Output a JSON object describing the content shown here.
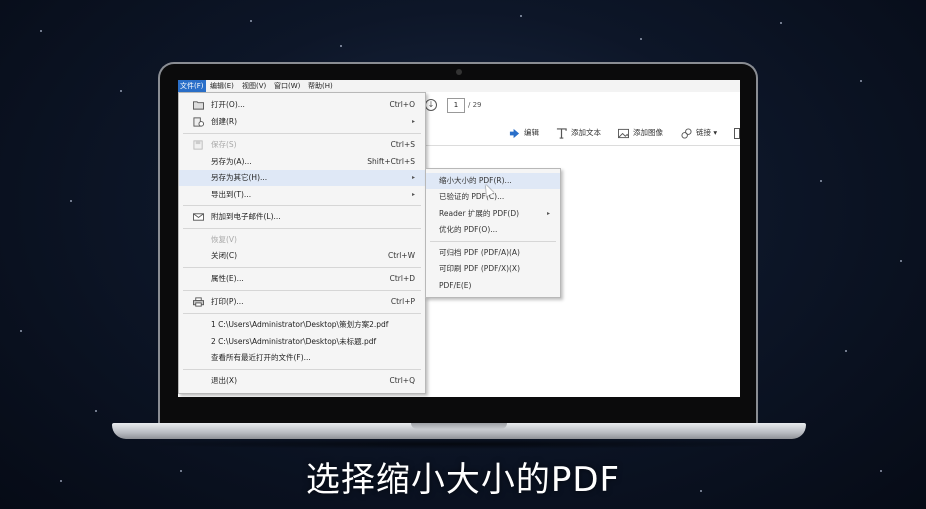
{
  "menubar": [
    "文件(F)",
    "编辑(E)",
    "视图(V)",
    "窗口(W)",
    "帮助(H)"
  ],
  "toolbar": {
    "page_number": "1",
    "page_total": "/ 29",
    "edit": "编辑",
    "add_text": "添加文本",
    "add_image": "添加图像",
    "link": "链接 ▾"
  },
  "file_menu": [
    {
      "label": "打开(O)...",
      "shortcut": "Ctrl+O",
      "icon": "folder-open-icon"
    },
    {
      "label": "创建(R)",
      "shortcut": "",
      "icon": "create-icon",
      "submenu": true
    },
    {
      "label": "保存(S)",
      "shortcut": "Ctrl+S",
      "icon": "save-icon",
      "disabled": true
    },
    {
      "label": "另存为(A)...",
      "shortcut": "Shift+Ctrl+S"
    },
    {
      "label": "另存为其它(H)...",
      "shortcut": "",
      "submenu": true,
      "highlighted": true
    },
    {
      "label": "导出到(T)...",
      "shortcut": "",
      "submenu": true
    },
    {
      "label": "附加到电子邮件(L)...",
      "shortcut": "",
      "icon": "mail-icon"
    },
    {
      "label": "恢复(V)",
      "shortcut": "",
      "disabled": true
    },
    {
      "label": "关闭(C)",
      "shortcut": "Ctrl+W"
    },
    {
      "label": "属性(E)...",
      "shortcut": "Ctrl+D"
    },
    {
      "label": "打印(P)...",
      "shortcut": "Ctrl+P",
      "icon": "print-icon"
    },
    {
      "label": "1 C:\\Users\\Administrator\\Desktop\\策划方案2.pdf",
      "shortcut": ""
    },
    {
      "label": "2 C:\\Users\\Administrator\\Desktop\\未标题.pdf",
      "shortcut": ""
    },
    {
      "label": "查看所有最近打开的文件(F)...",
      "shortcut": ""
    },
    {
      "label": "退出(X)",
      "shortcut": "Ctrl+Q"
    }
  ],
  "sub_menu": [
    {
      "label": "缩小大小的 PDF(R)...",
      "highlighted": true
    },
    {
      "label": "已验证的 PDF(C)..."
    },
    {
      "label": "Reader 扩展的 PDF(D)",
      "submenu": true
    },
    {
      "label": "优化的 PDF(O)..."
    },
    {
      "label": "可归档 PDF (PDF/A)(A)"
    },
    {
      "label": "可印刷 PDF (PDF/X)(X)"
    },
    {
      "label": "PDF/E(E)"
    }
  ],
  "caption": "选择缩小大小的PDF",
  "colors": {
    "menu_highlight": "#dfe8f6",
    "active_menu": "#2a6fc9",
    "edit_icon": "#2a6fc9"
  }
}
